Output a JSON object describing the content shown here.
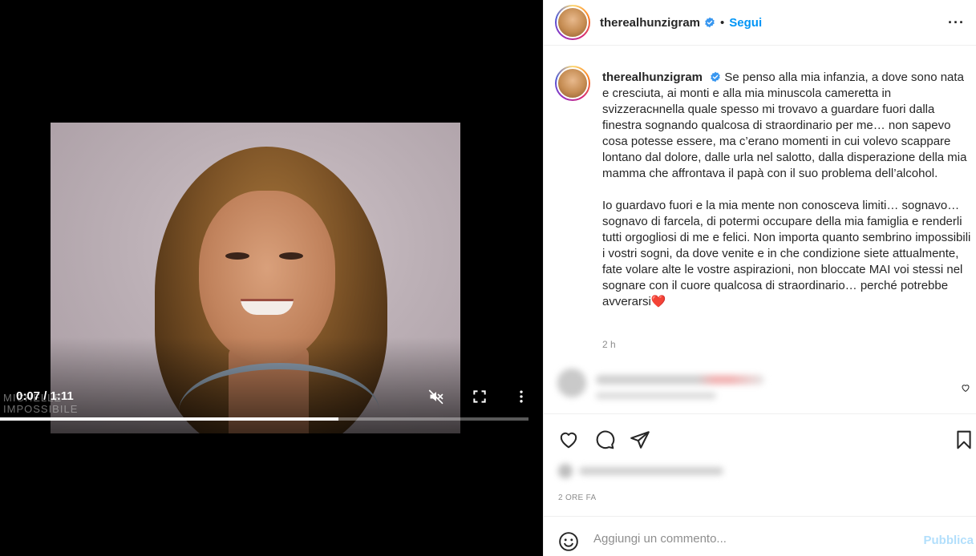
{
  "video": {
    "current_time": "0:07",
    "separator": " / ",
    "duration": "1:11",
    "watermark_line1": "MICHELLE",
    "watermark_line2": "IMPOSSIBILE",
    "progress_fraction": 0.64
  },
  "post": {
    "username": "therealhunzigram",
    "dot": "•",
    "follow_label": "Segui",
    "more_label": "···",
    "caption_p1": "Se penso alla mia infanzia, a dove sono nata e cresciuta, ai monti e alla mia minuscola cameretta in svizzeracнnella quale spesso mi trovavo a guardare fuori dalla finestra sognando qualcosa di straordinario per me… non sapevo cosa potesse essere, ma c’erano momenti in cui volevo scappare lontano dal dolore, dalle urla nel salotto, dalla disperazione della mia mamma che affrontava il papà con il suo problema dell’alcohol.",
    "caption_p2": "Io guardavo fuori e la mia mente non conosceva limiti… sognavo… sognavo di farcela, di potermi occupare della mia famiglia e renderli tutti orgogliosi di me e felici. Non importa quanto sembrino impossibili i vostri sogni, da dove venite e in che condizione siete attualmente, fate volare alte le vostre aspirazioni, non bloccate MAI voi stessi nel",
    "caption_p3": "sognare con il cuore qualcosa di straordinario… perché potrebbe avverarsi",
    "caption_emoji": "❤️",
    "caption_time": "2 h",
    "time_ago": "2 ORE FA"
  },
  "comment_box": {
    "placeholder": "Aggiungi un commento...",
    "publish_label": "Pubblica"
  },
  "colors": {
    "accent": "#0095f6",
    "publish_disabled": "#b2dffc",
    "verified": "#3897f0",
    "heart": "#ed4956"
  }
}
